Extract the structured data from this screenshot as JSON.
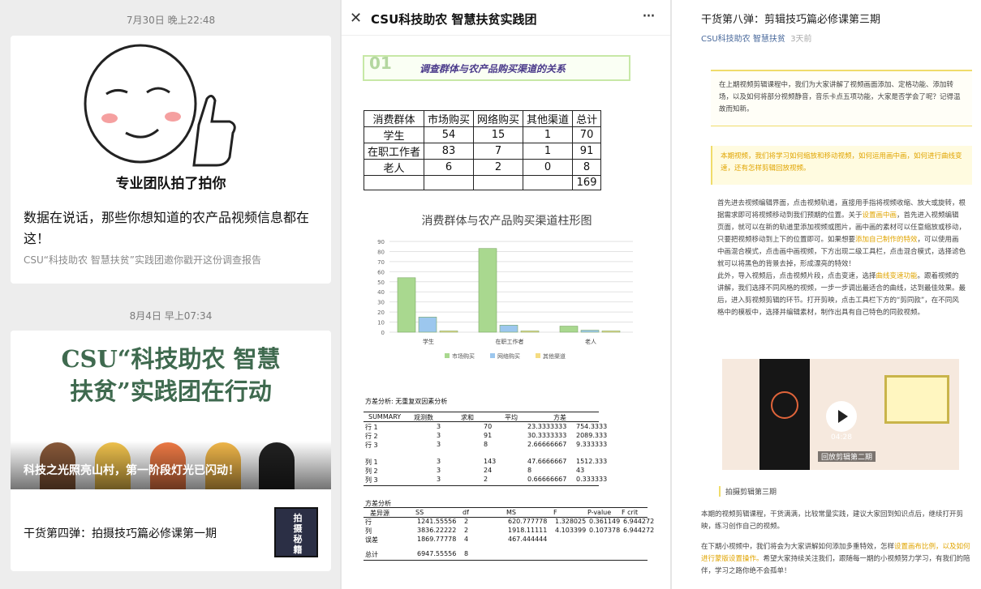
{
  "left": {
    "msg1": {
      "time": "7月30日 晚上22:48",
      "image_caption": "专业团队拍了拍你",
      "title": "数据在说话，那些你想知道的农产品视频信息都在这！",
      "subtitle": "CSU“科技助农 智慧扶贫”实践团邀你戳开这份调查报告"
    },
    "msg2": {
      "time": "8月4日 早上07:34",
      "banner_line1": "CSU“科技助农 智慧",
      "banner_line2": "扶贫”实践团在行动",
      "overlay_title": "科技之光照亮山村，第一阶段灯光已闪动！",
      "item_title": "干货第四弹：拍摄技巧篇必修课第一期",
      "thumb_text": "拍摄秘籍"
    }
  },
  "middle": {
    "header": {
      "title": "CSU科技助农 智慧扶贫实践团"
    },
    "section": {
      "num": "01",
      "title": "调查群体与农产品购买渠道的关系"
    },
    "table": {
      "headers": [
        "消费群体",
        "市场购买",
        "网络购买",
        "其他渠道",
        "总计"
      ],
      "rows": [
        [
          "学生",
          "54",
          "15",
          "1",
          "70"
        ],
        [
          "在职工作者",
          "83",
          "7",
          "1",
          "91"
        ],
        [
          "老人",
          "6",
          "2",
          "0",
          "8"
        ],
        [
          "",
          "",
          "",
          "",
          "169"
        ]
      ]
    },
    "chart_data": {
      "type": "bar",
      "title": "消费群体与农产品购买渠道柱形图",
      "categories": [
        "学生",
        "在职工作者",
        "老人"
      ],
      "series": [
        {
          "name": "市场购买",
          "values": [
            54,
            83,
            6
          ],
          "color": "#a9d88f"
        },
        {
          "name": "网络购买",
          "values": [
            15,
            7,
            2
          ],
          "color": "#9cc7ee"
        },
        {
          "name": "其他渠道",
          "values": [
            1,
            1,
            0
          ],
          "color": "#f5dc82"
        }
      ],
      "yticks": [
        "0",
        "10",
        "20",
        "30",
        "40",
        "50",
        "60",
        "70",
        "80",
        "90"
      ],
      "ylim": [
        0,
        90
      ],
      "legend": "bottom"
    },
    "anova": {
      "title": "方差分析: 无重复双因素分析",
      "summary_headers": [
        "SUMMARY",
        "观测数",
        "求和",
        "平均",
        "方差"
      ],
      "rows_a": [
        [
          "行 1",
          "3",
          "70",
          "23.3333333",
          "754.3333"
        ],
        [
          "行 2",
          "3",
          "91",
          "30.3333333",
          "2089.333"
        ],
        [
          "行 3",
          "3",
          "8",
          "2.66666667",
          "9.333333"
        ]
      ],
      "rows_b": [
        [
          "列 1",
          "3",
          "143",
          "47.6666667",
          "1512.333"
        ],
        [
          "列 2",
          "3",
          "24",
          "8",
          "43"
        ],
        [
          "列 3",
          "3",
          "2",
          "0.66666667",
          "0.333333"
        ]
      ],
      "title2": "方差分析",
      "anova_headers": [
        "差异源",
        "SS",
        "df",
        "MS",
        "F",
        "P-value",
        "F crit"
      ],
      "rows_c": [
        [
          "行",
          "1241.55556",
          "2",
          "620.777778",
          "1.328025",
          "0.361149",
          "6.944272"
        ],
        [
          "列",
          "3836.22222",
          "2",
          "1918.11111",
          "4.103399",
          "0.107378",
          "6.944272"
        ],
        [
          "误差",
          "1869.77778",
          "4",
          "467.444444",
          "",
          "",
          ""
        ]
      ],
      "total": [
        "总计",
        "6947.55556",
        "8",
        "",
        "",
        "",
        ""
      ]
    }
  },
  "right": {
    "title": "干货第八弹：剪辑技巧篇必修课第三期",
    "account": "CSU科技助农 智慧扶贫",
    "age": "3天前",
    "intro": "在上期视频剪辑课程中，我们为大家讲解了视频画面添加、定格功能、添加转场，以及如何将部分视频静音，音乐卡点五项功能，大家是否学会了呢？记得温故而知新。",
    "highlight": "本期视频，我们将学习如何缩放和移动视频，如何运用画中画，如何进行曲线变速，还有怎样剪辑回放视频。",
    "para1a": "首先进去视频编辑界面，点击视频轨道，直接用手指将视频收缩、放大或旋转，根据需求即可将视频移动到我们预期的位置。关于",
    "para1hl1": "设置画中画",
    "para1b": "，首先进入视频编辑页面，就可以在新的轨道里添加视频或图片，画中画的素材可以任意缩放或移动，只要把视频移动到上下的位置即可。如果想要",
    "para1hl2": "添加自己制作的特效",
    "para1c": "，可以使用画中画混合模式，点击画中画视频，下方出现二级工具栏，点击混合模式，选择滤色就可以将黑色的背景去掉，形成漂亮的特效！",
    "para2a": "此外，导入视频后，点击视频片段，点击变速，选择",
    "para2hl": "曲线变速功能",
    "para2b": "。跟着视频的讲解，我们选择不同风格的视频，一步一步调出最适合的曲线，达到最佳效果。最后，进入剪视频剪辑的环节。打开剪映，点击工具栏下方的“剪同款”，在不同风格中的模板中，选择并编辑素材，制作出具有自己特色的同款视频。",
    "video_time": "04:28",
    "video_caption": "回放剪辑第二期",
    "tag": "拍摄剪辑第三期",
    "para3": "本期的视频剪辑课程，干货满满，比较常量实践，建议大家回到知识点后，继续打开剪映，练习创作自己的视频。",
    "para4a": "在下期小视频中，我们将会为大家讲解如何添加多重特效，怎样",
    "para4hl": "设置画布比例，以及如何进行蒙版设置操作。",
    "para4b": "希望大家持续关注我们，跟随每一期的小视频努力学习，有我们的陪伴，学习之路你绝不会孤单！"
  }
}
